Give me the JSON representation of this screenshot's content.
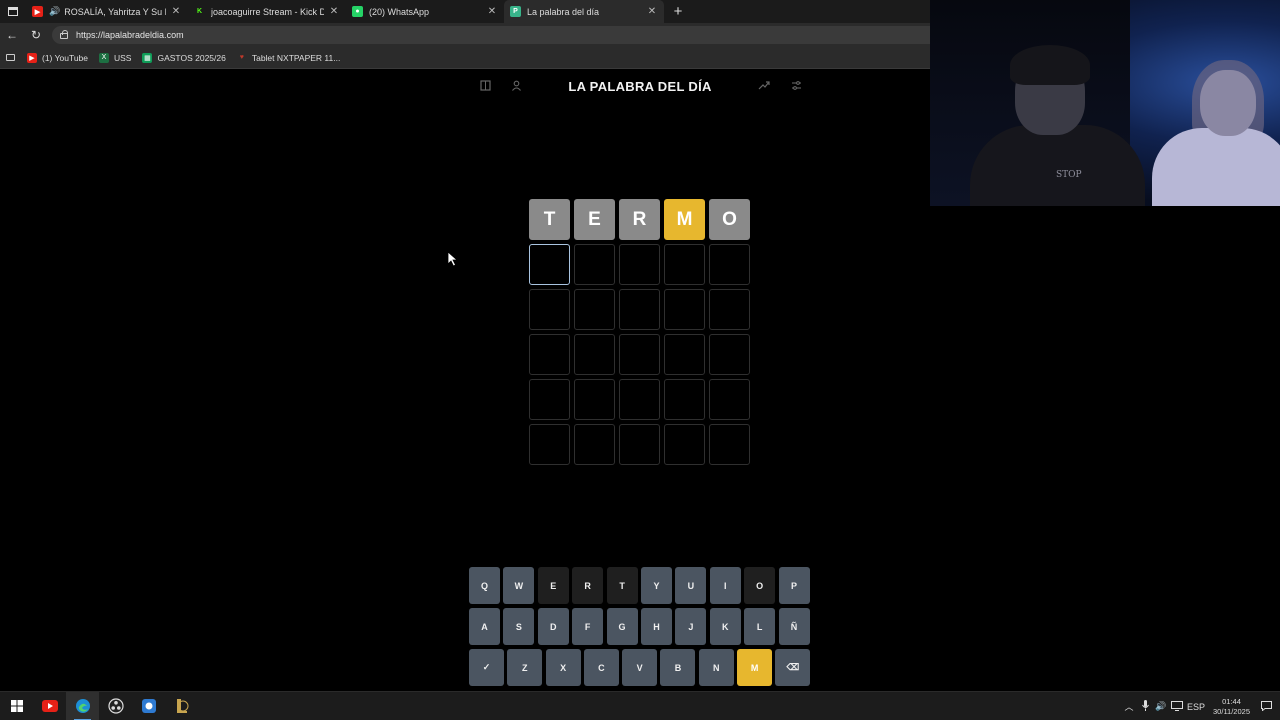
{
  "browser": {
    "tabs": [
      {
        "title": "ROSALÍA, Yahritza Y Su Esen",
        "favicon": "youtube-icon",
        "audio": true,
        "active": false
      },
      {
        "title": "joacoaguirre Stream - Kick Dashb",
        "favicon": "kick-icon",
        "audio": false,
        "active": false
      },
      {
        "title": "(20) WhatsApp",
        "favicon": "whatsapp-icon",
        "audio": false,
        "active": false
      },
      {
        "title": "La palabra del día",
        "favicon": "palabra-icon",
        "audio": false,
        "active": true
      }
    ],
    "url": "https://lapalabradeldia.com",
    "bookmarks": [
      {
        "label": "(1) YouTube",
        "icon": "youtube-icon"
      },
      {
        "label": "USS",
        "icon": "excel-icon"
      },
      {
        "label": "GASTOS 2025/26",
        "icon": "sheets-icon"
      },
      {
        "label": "Tablet NXTPAPER 11...",
        "icon": "tcl-icon"
      }
    ]
  },
  "game": {
    "title": "LA PALABRA DEL DÍA",
    "board": [
      [
        {
          "l": "T",
          "s": "absent"
        },
        {
          "l": "E",
          "s": "absent"
        },
        {
          "l": "R",
          "s": "absent"
        },
        {
          "l": "M",
          "s": "present"
        },
        {
          "l": "O",
          "s": "absent"
        }
      ],
      [
        {
          "l": "",
          "s": "focus"
        },
        {
          "l": "",
          "s": "empty"
        },
        {
          "l": "",
          "s": "empty"
        },
        {
          "l": "",
          "s": "empty"
        },
        {
          "l": "",
          "s": "empty"
        }
      ],
      [
        {
          "l": "",
          "s": "empty"
        },
        {
          "l": "",
          "s": "empty"
        },
        {
          "l": "",
          "s": "empty"
        },
        {
          "l": "",
          "s": "empty"
        },
        {
          "l": "",
          "s": "empty"
        }
      ],
      [
        {
          "l": "",
          "s": "empty"
        },
        {
          "l": "",
          "s": "empty"
        },
        {
          "l": "",
          "s": "empty"
        },
        {
          "l": "",
          "s": "empty"
        },
        {
          "l": "",
          "s": "empty"
        }
      ],
      [
        {
          "l": "",
          "s": "empty"
        },
        {
          "l": "",
          "s": "empty"
        },
        {
          "l": "",
          "s": "empty"
        },
        {
          "l": "",
          "s": "empty"
        },
        {
          "l": "",
          "s": "empty"
        }
      ],
      [
        {
          "l": "",
          "s": "empty"
        },
        {
          "l": "",
          "s": "empty"
        },
        {
          "l": "",
          "s": "empty"
        },
        {
          "l": "",
          "s": "empty"
        },
        {
          "l": "",
          "s": "empty"
        }
      ]
    ],
    "keyboard": [
      [
        {
          "k": "Q",
          "s": "unused"
        },
        {
          "k": "W",
          "s": "unused"
        },
        {
          "k": "E",
          "s": "absent"
        },
        {
          "k": "R",
          "s": "absent"
        },
        {
          "k": "T",
          "s": "absent"
        },
        {
          "k": "Y",
          "s": "unused"
        },
        {
          "k": "U",
          "s": "unused"
        },
        {
          "k": "I",
          "s": "unused"
        },
        {
          "k": "O",
          "s": "absent"
        },
        {
          "k": "P",
          "s": "unused"
        }
      ],
      [
        {
          "k": "A",
          "s": "unused"
        },
        {
          "k": "S",
          "s": "unused"
        },
        {
          "k": "D",
          "s": "unused"
        },
        {
          "k": "F",
          "s": "unused"
        },
        {
          "k": "G",
          "s": "unused"
        },
        {
          "k": "H",
          "s": "unused"
        },
        {
          "k": "J",
          "s": "unused"
        },
        {
          "k": "K",
          "s": "unused"
        },
        {
          "k": "L",
          "s": "unused"
        },
        {
          "k": "Ñ",
          "s": "unused"
        }
      ],
      [
        {
          "k": "✓",
          "s": "unused",
          "name": "enter"
        },
        {
          "k": "Z",
          "s": "unused"
        },
        {
          "k": "X",
          "s": "unused"
        },
        {
          "k": "C",
          "s": "unused"
        },
        {
          "k": "V",
          "s": "unused"
        },
        {
          "k": "B",
          "s": "unused"
        },
        {
          "k": "N",
          "s": "unused"
        },
        {
          "k": "M",
          "s": "present"
        },
        {
          "k": "⌫",
          "s": "unused",
          "name": "backspace"
        }
      ]
    ]
  },
  "webcam": {
    "shirt_text": "STOP"
  },
  "taskbar": {
    "lang": "ESP",
    "time": "01:44",
    "date": "30/11/2025"
  },
  "colors": {
    "present": "#e7b72e",
    "absent_tile": "#8a8a8a",
    "key": "#4b5561",
    "key_absent": "#1f1f1f"
  }
}
